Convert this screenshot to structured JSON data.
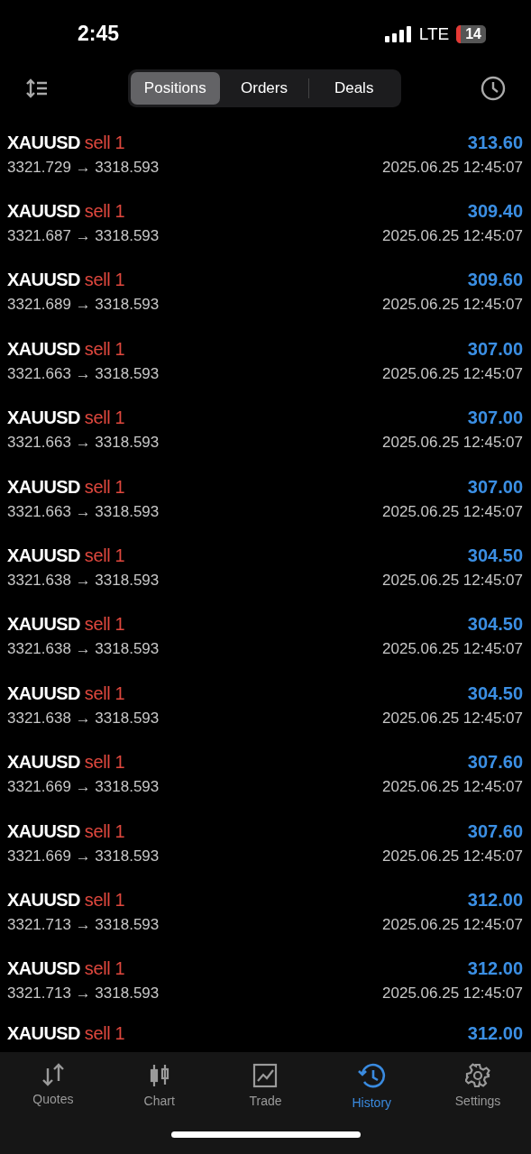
{
  "status_bar": {
    "time": "2:45",
    "network": "LTE",
    "battery": "14"
  },
  "tabs": [
    {
      "label": "Positions",
      "selected": true
    },
    {
      "label": "Orders",
      "selected": false
    },
    {
      "label": "Deals",
      "selected": false
    }
  ],
  "deals": [
    {
      "symbol": "XAUUSD",
      "side": "sell 1",
      "profit": "313.60",
      "prices": "3321.729 → 3318.593",
      "time": "2025.06.25 12:45:07"
    },
    {
      "symbol": "XAUUSD",
      "side": "sell 1",
      "profit": "309.40",
      "prices": "3321.687 → 3318.593",
      "time": "2025.06.25 12:45:07"
    },
    {
      "symbol": "XAUUSD",
      "side": "sell 1",
      "profit": "309.60",
      "prices": "3321.689 → 3318.593",
      "time": "2025.06.25 12:45:07"
    },
    {
      "symbol": "XAUUSD",
      "side": "sell 1",
      "profit": "307.00",
      "prices": "3321.663 → 3318.593",
      "time": "2025.06.25 12:45:07"
    },
    {
      "symbol": "XAUUSD",
      "side": "sell 1",
      "profit": "307.00",
      "prices": "3321.663 → 3318.593",
      "time": "2025.06.25 12:45:07"
    },
    {
      "symbol": "XAUUSD",
      "side": "sell 1",
      "profit": "307.00",
      "prices": "3321.663 → 3318.593",
      "time": "2025.06.25 12:45:07"
    },
    {
      "symbol": "XAUUSD",
      "side": "sell 1",
      "profit": "304.50",
      "prices": "3321.638 → 3318.593",
      "time": "2025.06.25 12:45:07"
    },
    {
      "symbol": "XAUUSD",
      "side": "sell 1",
      "profit": "304.50",
      "prices": "3321.638 → 3318.593",
      "time": "2025.06.25 12:45:07"
    },
    {
      "symbol": "XAUUSD",
      "side": "sell 1",
      "profit": "304.50",
      "prices": "3321.638 → 3318.593",
      "time": "2025.06.25 12:45:07"
    },
    {
      "symbol": "XAUUSD",
      "side": "sell 1",
      "profit": "307.60",
      "prices": "3321.669 → 3318.593",
      "time": "2025.06.25 12:45:07"
    },
    {
      "symbol": "XAUUSD",
      "side": "sell 1",
      "profit": "307.60",
      "prices": "3321.669 → 3318.593",
      "time": "2025.06.25 12:45:07"
    },
    {
      "symbol": "XAUUSD",
      "side": "sell 1",
      "profit": "312.00",
      "prices": "3321.713 → 3318.593",
      "time": "2025.06.25 12:45:07"
    },
    {
      "symbol": "XAUUSD",
      "side": "sell 1",
      "profit": "312.00",
      "prices": "3321.713 → 3318.593",
      "time": "2025.06.25 12:45:07"
    },
    {
      "symbol": "XAUUSD",
      "side": "sell 1",
      "profit": "312.00"
    }
  ],
  "nav": [
    {
      "label": "Quotes",
      "kind": "quotes",
      "selected": false
    },
    {
      "label": "Chart",
      "kind": "chart",
      "selected": false
    },
    {
      "label": "Trade",
      "kind": "trade",
      "selected": false
    },
    {
      "label": "History",
      "kind": "history",
      "selected": true
    },
    {
      "label": "Settings",
      "kind": "settings",
      "selected": false
    }
  ]
}
